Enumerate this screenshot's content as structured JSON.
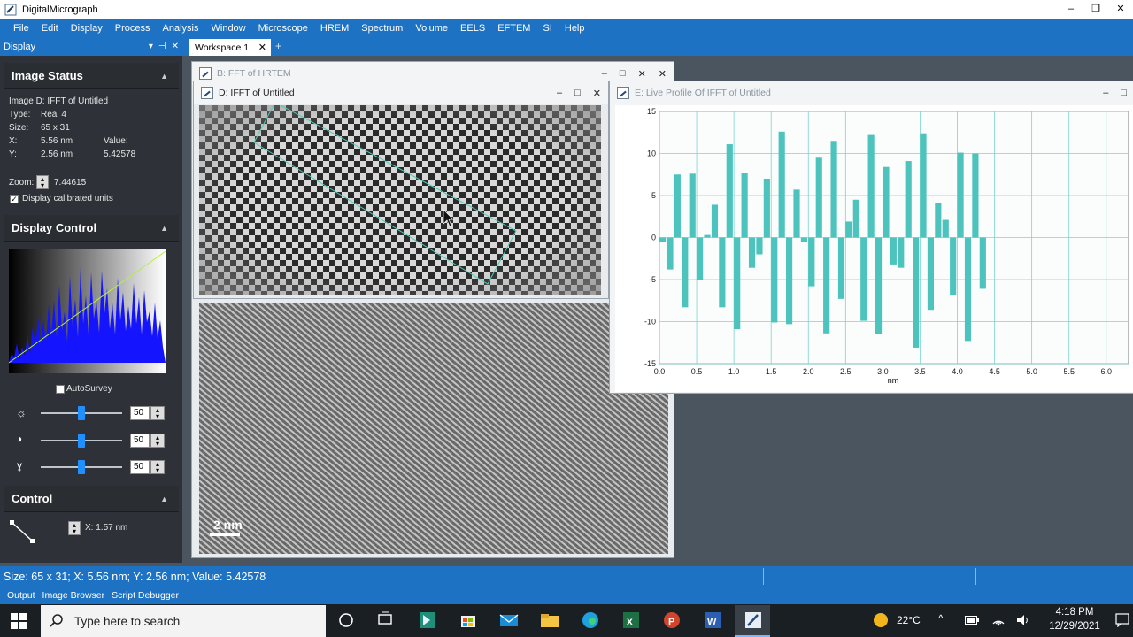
{
  "app": {
    "title": "DigitalMicrograph",
    "window_buttons": [
      "–",
      "❐",
      "✕"
    ]
  },
  "menu": [
    "File",
    "Edit",
    "Display",
    "Process",
    "Analysis",
    "Window",
    "Microscope",
    "HREM",
    "Spectrum",
    "Volume",
    "EELS",
    "EFTEM",
    "SI",
    "Help"
  ],
  "left_header": {
    "label": "Display",
    "buttons": [
      "▾",
      "⊣",
      "✕"
    ]
  },
  "workspace_tab": {
    "label": "Workspace 1",
    "close": "✕",
    "add": "+"
  },
  "image_status": {
    "heading": "Image Status",
    "image_label": "Image D: IFFT of Untitled",
    "type_label": "Type:",
    "type_value": "Real 4",
    "size_label": "Size:",
    "size_value": "65 x 31",
    "x_label": "X:",
    "x_value": "5.56 nm",
    "value_label": "Value:",
    "y_label": "Y:",
    "y_value": "2.56 nm",
    "value_value": "5.42578",
    "zoom_label": "Zoom:",
    "zoom_value": "7.44615",
    "calibrated_label": "Display calibrated units"
  },
  "display_control": {
    "heading": "Display Control",
    "autosurvey_label": "AutoSurvey",
    "sliders": [
      {
        "icon": "brightness-icon",
        "value": "50",
        "level": 0.5
      },
      {
        "icon": "contrast-icon",
        "value": "50",
        "level": 0.5
      },
      {
        "icon": "gamma-icon",
        "value": "50",
        "level": 0.5
      }
    ]
  },
  "control": {
    "heading": "Control",
    "x_readout": "X: 1.57 nm"
  },
  "windows": {
    "back": {
      "title": "B: FFT of HRTEM"
    },
    "ifft": {
      "title": "D: IFFT of Untitled"
    },
    "profile": {
      "title": "E: Live Profile Of IFFT of Untitled"
    },
    "hrtem": {
      "scalebar_label": "2 nm"
    }
  },
  "chart_data": {
    "type": "bar",
    "xlabel": "nm",
    "ylabel": "",
    "xlim": [
      0.0,
      6.3
    ],
    "ylim": [
      -15,
      15
    ],
    "xticks": [
      "0.0",
      "0.5",
      "1.0",
      "1.5",
      "2.0",
      "2.5",
      "3.0",
      "3.5",
      "4.0",
      "4.5",
      "5.0",
      "5.5",
      "6.0"
    ],
    "yticks": [
      "15",
      "10",
      "5",
      "0",
      "-5",
      "-10",
      "-15"
    ],
    "grid": true,
    "color": "#4cc3bd",
    "x": [
      0.0,
      0.1,
      0.2,
      0.3,
      0.4,
      0.5,
      0.6,
      0.7,
      0.8,
      0.9,
      1.0,
      1.1,
      1.2,
      1.3,
      1.4,
      1.5,
      1.6,
      1.7,
      1.8,
      1.9,
      2.0,
      2.1,
      2.2,
      2.3,
      2.4,
      2.5,
      2.6,
      2.7,
      2.8,
      2.9,
      3.0,
      3.1,
      3.2,
      3.3,
      3.4,
      3.5,
      3.6,
      3.7,
      3.8,
      3.9,
      4.0,
      4.1,
      4.2,
      4.3,
      4.4,
      4.5,
      4.6,
      4.7,
      4.8,
      4.9,
      5.0,
      5.1,
      5.2,
      5.3,
      5.4,
      5.5,
      5.6,
      5.7,
      5.8,
      5.9,
      6.0,
      6.1,
      6.2
    ],
    "values": [
      -0.5,
      -3.8,
      7.5,
      -8.3,
      7.6,
      -5.0,
      0.3,
      3.9,
      -8.3,
      11.1,
      -10.9,
      7.7,
      -3.6,
      -2.0,
      7.0,
      -10.1,
      12.6,
      -10.3,
      5.7,
      -0.5,
      -5.8,
      9.5,
      -11.4,
      11.5,
      -7.3,
      1.9,
      4.5,
      -9.9,
      12.2,
      -11.5,
      8.4,
      -3.2,
      -3.6,
      9.1,
      -13.1,
      12.4,
      -8.6,
      4.1,
      2.1,
      -6.9,
      10.1,
      -12.3,
      10.0,
      -6.1
    ]
  },
  "status_bar": {
    "text": "Size: 65 x 31;  X: 5.56 nm;  Y: 2.56 nm;  Value: 5.42578"
  },
  "output_bar": [
    "Output",
    "Image Browser",
    "Script Debugger"
  ],
  "taskbar": {
    "search_placeholder": "Type here to search",
    "weather": "22°C",
    "time": "4:18 PM",
    "date": "12/29/2021"
  }
}
